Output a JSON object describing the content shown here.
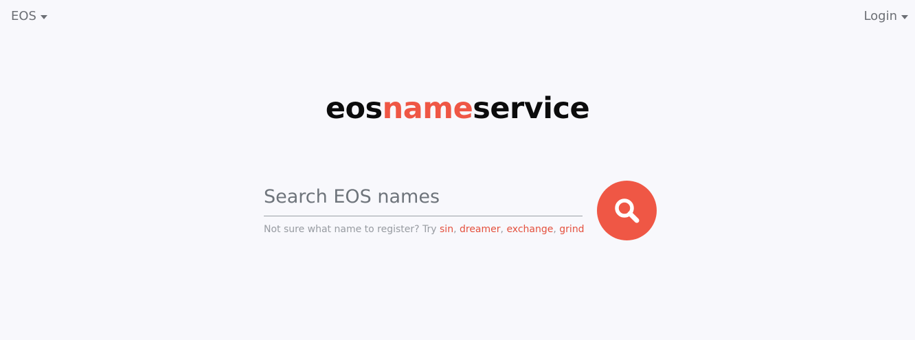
{
  "nav": {
    "network_label": "EOS",
    "login_label": "Login"
  },
  "logo": {
    "part1": "eos",
    "part2": "name",
    "part3": "service"
  },
  "search": {
    "placeholder": "Search EOS names",
    "value": "",
    "hint_prefix": "Not sure what name to register? Try ",
    "suggestions": [
      "sin",
      "dreamer",
      "exchange",
      "grind"
    ],
    "button_icon": "search-icon"
  },
  "colors": {
    "accent": "#ef5745",
    "text_muted": "#979ba1",
    "background": "#f8f8fc"
  }
}
